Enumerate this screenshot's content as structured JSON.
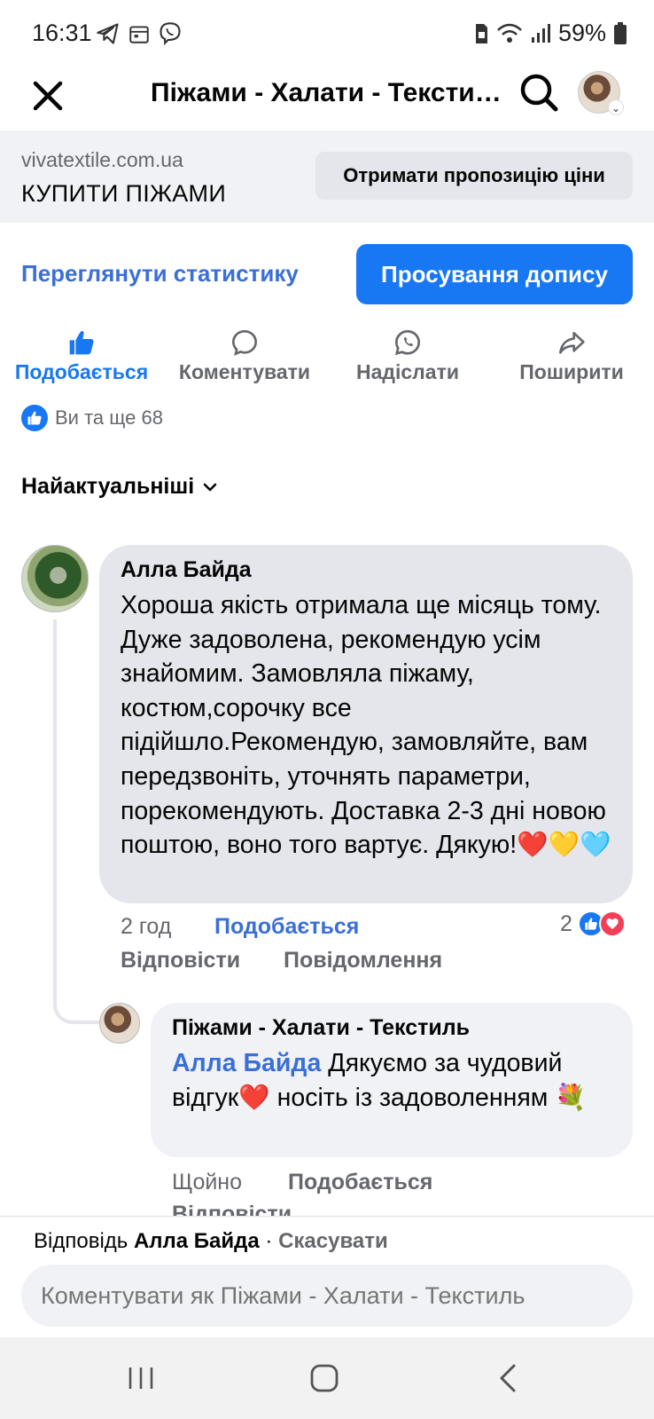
{
  "status": {
    "time": "16:31",
    "battery": "59%"
  },
  "topbar": {
    "title": "Піжами - Халати - Текстиль"
  },
  "cta": {
    "domain": "vivatextile.com.ua",
    "headline": "КУПИТИ ПІЖАМИ",
    "button": "Отримати пропозицію ціни"
  },
  "post_actions": {
    "stats_link": "Переглянути статистику",
    "boost_button": "Просування допису",
    "like": "Подобається",
    "comment": "Коментувати",
    "send": "Надіслати",
    "share": "Поширити"
  },
  "reactions_summary": "Ви та ще 68",
  "sort_label": "Найактуальніші",
  "comment": {
    "author": "Алла Байда",
    "text": "Хороша якість отримала ще місяць тому. Дуже задоволена, рекомендую усім знайомим. Замовляла піжаму, костюм,сорочку все підійшло.Рекомендую, замовляйте, вам передзвоніть, уточнять параметри, порекомендують. Доставка 2-3 дні новою поштою, воно того вартує. Дякую!",
    "emojis": "❤️💛🩵",
    "time": "2 год",
    "like": "Подобається",
    "reaction_count": "2",
    "reply": "Відповісти",
    "message": "Повідомлення"
  },
  "reply": {
    "author": "Піжами - Халати - Текстиль",
    "mention": "Алла Байда",
    "text_part1": " Дякуємо за чудовий відгук",
    "heart": "❤️",
    "text_part2": "  носіть із задоволенням ",
    "bouquet": "💐",
    "time": "Щойно",
    "like": "Подобається",
    "reply": "Відповісти"
  },
  "composer": {
    "reply_prefix": "Відповідь",
    "reply_to": "Алла Байда",
    "separator": " · ",
    "cancel": "Скасувати",
    "placeholder": "Коментувати як Піжами - Халати - Текстиль"
  }
}
